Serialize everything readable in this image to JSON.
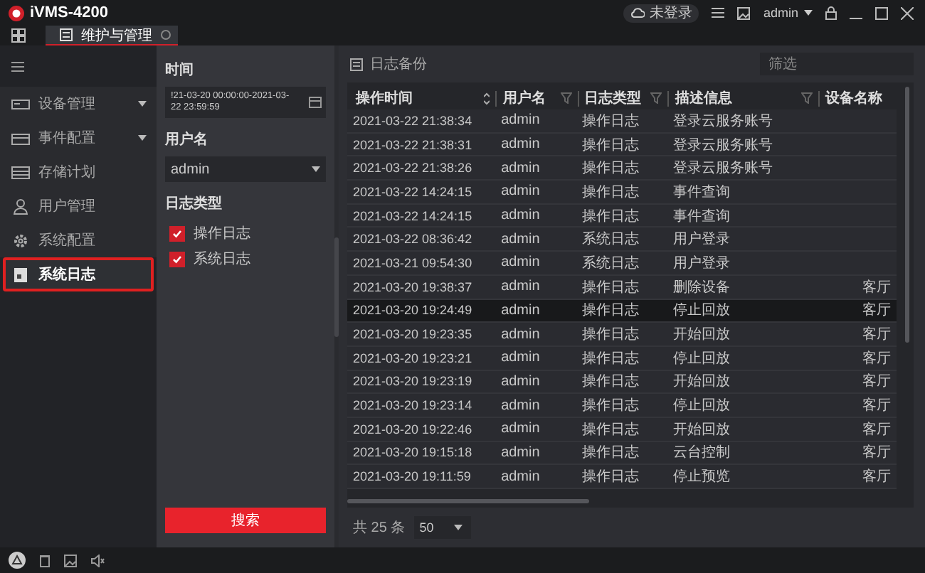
{
  "window": {
    "title": "iVMS-4200",
    "cloud": "未登录",
    "user": "admin"
  },
  "tabs": [
    {
      "label": "维护与管理",
      "selected": true
    }
  ],
  "sidebar": {
    "items": [
      {
        "label": "设备管理",
        "expandable": true,
        "selected": false
      },
      {
        "label": "事件配置",
        "expandable": true,
        "selected": false
      },
      {
        "label": "存储计划",
        "expandable": false,
        "selected": false
      },
      {
        "label": "用户管理",
        "expandable": false,
        "selected": false
      },
      {
        "label": "系统配置",
        "expandable": false,
        "selected": false
      },
      {
        "label": "系统日志",
        "expandable": false,
        "selected": true
      }
    ]
  },
  "filter": {
    "time_label": "时间",
    "time_value": "!21-03-20 00:00:00-2021-03-22 23:59:59",
    "user_label": "用户名",
    "user_value": "admin",
    "type_label": "日志类型",
    "types": [
      {
        "label": "操作日志",
        "checked": true
      },
      {
        "label": "系统日志",
        "checked": true
      }
    ],
    "search_button": "搜索"
  },
  "content": {
    "backup": "日志备份",
    "filter_placeholder": "筛选",
    "table": {
      "columns": [
        {
          "label": "操作时间",
          "sortable": true,
          "filterable": false
        },
        {
          "label": "用户名",
          "sortable": false,
          "filterable": true
        },
        {
          "label": "日志类型",
          "sortable": false,
          "filterable": true
        },
        {
          "label": "描述信息",
          "sortable": false,
          "filterable": true
        },
        {
          "label": "设备名称",
          "sortable": false,
          "filterable": false
        }
      ],
      "rows": [
        {
          "cells": [
            "2021-03-22 21:38:34",
            "admin",
            "操作日志",
            "登录云服务账号",
            ""
          ],
          "selected": false
        },
        {
          "cells": [
            "2021-03-22 21:38:31",
            "admin",
            "操作日志",
            "登录云服务账号",
            ""
          ],
          "selected": false
        },
        {
          "cells": [
            "2021-03-22 21:38:26",
            "admin",
            "操作日志",
            "登录云服务账号",
            ""
          ],
          "selected": false
        },
        {
          "cells": [
            "2021-03-22 14:24:15",
            "admin",
            "操作日志",
            "事件查询",
            ""
          ],
          "selected": false
        },
        {
          "cells": [
            "2021-03-22 14:24:15",
            "admin",
            "操作日志",
            "事件查询",
            ""
          ],
          "selected": false
        },
        {
          "cells": [
            "2021-03-22 08:36:42",
            "admin",
            "系统日志",
            "用户登录",
            ""
          ],
          "selected": false
        },
        {
          "cells": [
            "2021-03-21 09:54:30",
            "admin",
            "系统日志",
            "用户登录",
            ""
          ],
          "selected": false
        },
        {
          "cells": [
            "2021-03-20 19:38:37",
            "admin",
            "操作日志",
            "删除设备",
            "客厅"
          ],
          "selected": false
        },
        {
          "cells": [
            "2021-03-20 19:24:49",
            "admin",
            "操作日志",
            "停止回放",
            "客厅"
          ],
          "selected": true
        },
        {
          "cells": [
            "2021-03-20 19:23:35",
            "admin",
            "操作日志",
            "开始回放",
            "客厅"
          ],
          "selected": false
        },
        {
          "cells": [
            "2021-03-20 19:23:21",
            "admin",
            "操作日志",
            "停止回放",
            "客厅"
          ],
          "selected": false
        },
        {
          "cells": [
            "2021-03-20 19:23:19",
            "admin",
            "操作日志",
            "开始回放",
            "客厅"
          ],
          "selected": false
        },
        {
          "cells": [
            "2021-03-20 19:23:14",
            "admin",
            "操作日志",
            "停止回放",
            "客厅"
          ],
          "selected": false
        },
        {
          "cells": [
            "2021-03-20 19:22:46",
            "admin",
            "操作日志",
            "开始回放",
            "客厅"
          ],
          "selected": false
        },
        {
          "cells": [
            "2021-03-20 19:15:18",
            "admin",
            "操作日志",
            "云台控制",
            "客厅"
          ],
          "selected": false
        },
        {
          "cells": [
            "2021-03-20 19:11:59",
            "admin",
            "操作日志",
            "停止预览",
            "客厅"
          ],
          "selected": false
        }
      ]
    },
    "total": "共 25 条",
    "page_size": "50"
  }
}
